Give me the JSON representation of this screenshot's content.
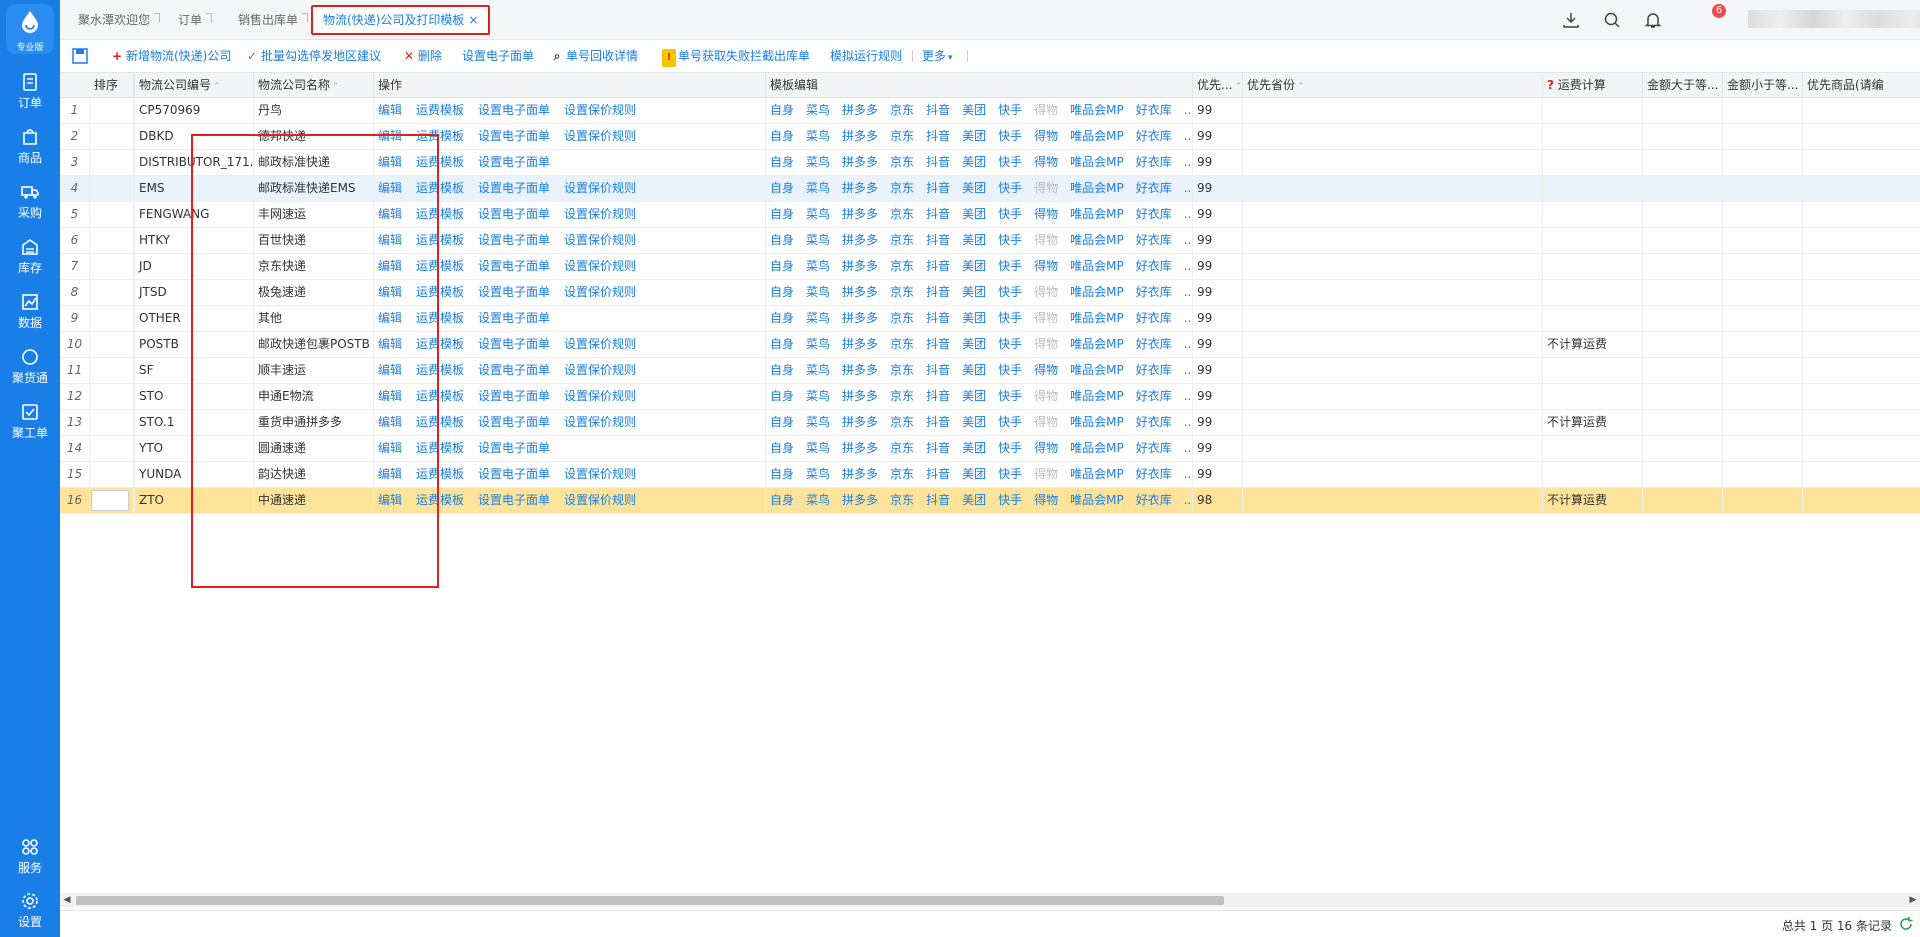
{
  "sidebar": {
    "logo_label": "专业版",
    "items": [
      {
        "label": "订单",
        "icon": "order-icon"
      },
      {
        "label": "商品",
        "icon": "goods-icon"
      },
      {
        "label": "采购",
        "icon": "truck-icon"
      },
      {
        "label": "库存",
        "icon": "warehouse-icon"
      },
      {
        "label": "数据",
        "icon": "chart-icon"
      },
      {
        "label": "聚货通",
        "icon": "circle-icon"
      },
      {
        "label": "聚工单",
        "icon": "ticket-icon"
      }
    ],
    "bottom": [
      {
        "label": "服务",
        "icon": "service-icon"
      },
      {
        "label": "设置",
        "icon": "gear-icon"
      }
    ]
  },
  "tabs": [
    {
      "label": "聚水潭欢迎您"
    },
    {
      "label": "订单"
    },
    {
      "label": "销售出库单"
    },
    {
      "label": "物流(快递)公司及打印模板",
      "close": "×"
    }
  ],
  "header": {
    "notification_count": "6"
  },
  "toolbar": {
    "add_label": "新增物流(快递)公司",
    "batch_label": "批量勾选停发地区建议",
    "delete_label": "删除",
    "set_waybill_label": "设置电子面单",
    "recycle_label": "单号回收详情",
    "intercept_label": "单号获取失败拦截出库单",
    "simulate_label": "模拟运行规则",
    "more_label": "更多"
  },
  "columns": {
    "sort": "排序",
    "code": "物流公司编号",
    "name": "物流公司名称",
    "ops": "操作",
    "templates": "模板编辑",
    "priority": "优先...",
    "pref_province": "优先省份",
    "freight": "运费计算",
    "amount_gt": "金额大于等...",
    "amount_lt": "金额小于等...",
    "pref_goods": "优先商品(请编"
  },
  "op_labels": [
    "编辑",
    "运费模板",
    "设置电子面单",
    "设置保价规则"
  ],
  "template_labels": [
    "自身",
    "菜鸟",
    "拼多多",
    "京东",
    "抖音",
    "美团",
    "快手",
    "得物",
    "唯品会MP",
    "好衣库",
    "..."
  ],
  "rows": [
    {
      "no": "1",
      "code": "CP570969",
      "name": "丹鸟",
      "ops": 4,
      "dewu": false,
      "priority": "99",
      "freight": ""
    },
    {
      "no": "2",
      "code": "DBKD",
      "name": "德邦快递",
      "ops": 4,
      "dewu": true,
      "priority": "99",
      "freight": ""
    },
    {
      "no": "3",
      "code": "DISTRIBUTOR_171...",
      "name": "邮政标准快递",
      "ops": 3,
      "dewu": true,
      "priority": "99",
      "freight": ""
    },
    {
      "no": "4",
      "code": "EMS",
      "name": "邮政标准快递EMS",
      "ops": 4,
      "dewu": false,
      "priority": "99",
      "freight": ""
    },
    {
      "no": "5",
      "code": "FENGWANG",
      "name": "丰网速运",
      "ops": 4,
      "dewu": true,
      "priority": "99",
      "freight": ""
    },
    {
      "no": "6",
      "code": "HTKY",
      "name": "百世快递",
      "ops": 4,
      "dewu": false,
      "priority": "99",
      "freight": ""
    },
    {
      "no": "7",
      "code": "JD",
      "name": "京东快递",
      "ops": 4,
      "dewu": true,
      "priority": "99",
      "freight": ""
    },
    {
      "no": "8",
      "code": "JTSD",
      "name": "极兔速递",
      "ops": 4,
      "dewu": false,
      "priority": "99",
      "freight": ""
    },
    {
      "no": "9",
      "code": "OTHER",
      "name": "其他",
      "ops": 3,
      "dewu": false,
      "priority": "99",
      "freight": ""
    },
    {
      "no": "10",
      "code": "POSTB",
      "name": "邮政快递包裹POSTB",
      "ops": 4,
      "dewu": false,
      "priority": "99",
      "freight": "不计算运费"
    },
    {
      "no": "11",
      "code": "SF",
      "name": "顺丰速运",
      "ops": 4,
      "dewu": true,
      "priority": "99",
      "freight": ""
    },
    {
      "no": "12",
      "code": "STO",
      "name": "申通E物流",
      "ops": 4,
      "dewu": false,
      "priority": "99",
      "freight": ""
    },
    {
      "no": "13",
      "code": "STO.1",
      "name": "重货申通拼多多",
      "ops": 4,
      "dewu": false,
      "priority": "99",
      "freight": "不计算运费"
    },
    {
      "no": "14",
      "code": "YTO",
      "name": "圆通速递",
      "ops": 3,
      "dewu": true,
      "priority": "99",
      "freight": ""
    },
    {
      "no": "15",
      "code": "YUNDA",
      "name": "韵达快递",
      "ops": 4,
      "dewu": false,
      "priority": "99",
      "freight": ""
    },
    {
      "no": "16",
      "code": "ZTO",
      "name": "中通速递",
      "ops": 4,
      "dewu": true,
      "priority": "98",
      "freight": "不计算运费"
    }
  ],
  "footer": {
    "summary": "总共 1 页 16 条记录"
  },
  "colors": {
    "brand": "#1a7ee8",
    "highlight_row": "#eaf2fb",
    "selected_row": "#fde49a",
    "annotation_red": "#e02020"
  }
}
